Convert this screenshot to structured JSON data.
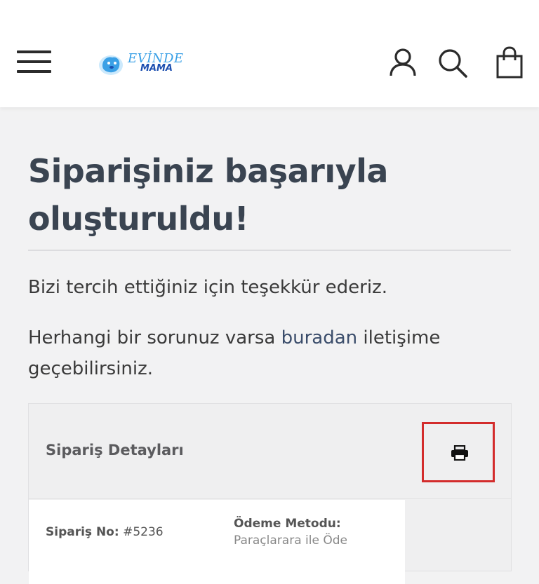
{
  "header": {
    "logo_line1": "EVİNDE",
    "logo_line2": "MAMA"
  },
  "main": {
    "title": "Siparişiniz başarıyla oluşturuldu!",
    "thanks_text": "Bizi tercih ettiğiniz için teşekkür ederiz.",
    "help_prefix": "Herhangi bir sorunuz varsa ",
    "help_link": "buradan",
    "help_suffix": " iletişime geçebilirsiniz."
  },
  "order_card": {
    "title": "Sipariş Detayları",
    "order_no_label": "Sipariş No:",
    "order_no_value": "#5236",
    "payment_label": "Ödeme Metodu:",
    "payment_value": "Paraçlarara ile Öde"
  },
  "colors": {
    "heading": "#3a4451",
    "link": "#3b4d6b",
    "highlight_box": "#d32c2c",
    "logo_blue": "#3aa0e6"
  },
  "icons": [
    "menu-icon",
    "dog-logo-icon",
    "user-icon",
    "search-icon",
    "shopping-bag-icon",
    "printer-icon"
  ]
}
